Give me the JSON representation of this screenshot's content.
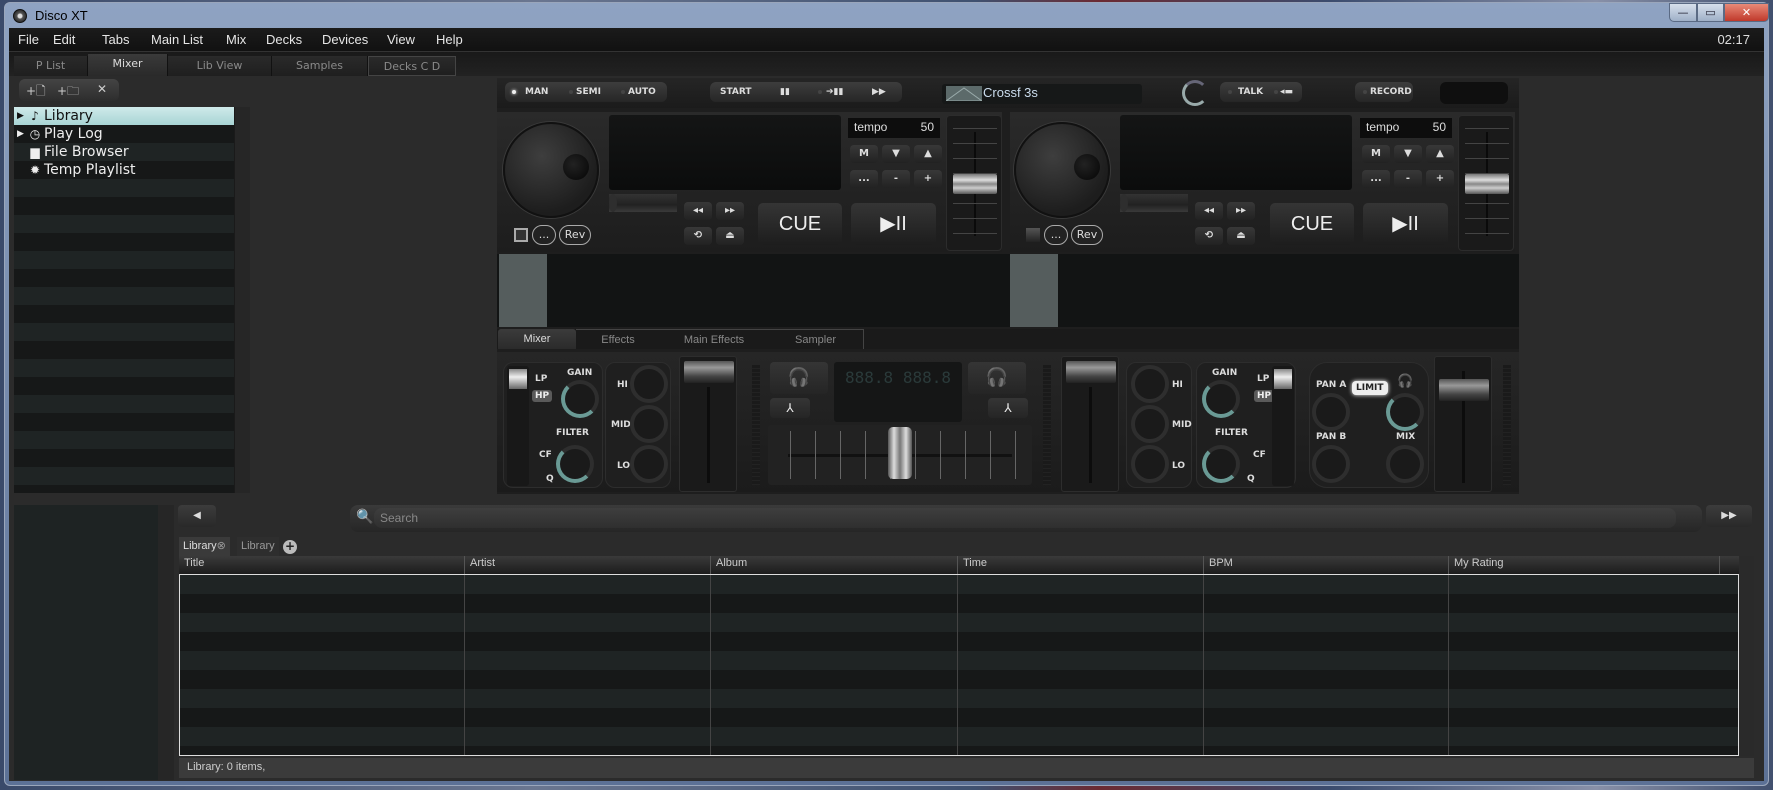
{
  "window": {
    "title": "Disco XT",
    "minimize": "—",
    "maximize": "▭",
    "close": "✕"
  },
  "menu": [
    "File",
    "Edit",
    "Tabs",
    "Main List",
    "Mix",
    "Decks",
    "Devices",
    "View",
    "Help"
  ],
  "clock": "02:17",
  "main_tabs": [
    {
      "label": "P List",
      "active": false
    },
    {
      "label": "Mixer",
      "active": true
    },
    {
      "label": "Lib View",
      "active": false
    },
    {
      "label": "Samples",
      "active": false
    },
    {
      "label": "Decks C D",
      "active": false
    }
  ],
  "tree_toolbar": {
    "new_playlist": "+🗋",
    "new_folder": "+🗀",
    "delete": "✕"
  },
  "tree": [
    {
      "label": "Library",
      "icon": "♪",
      "expandable": true,
      "selected": true
    },
    {
      "label": "Play Log",
      "icon": "◷",
      "expandable": true,
      "selected": false
    },
    {
      "label": "File Browser",
      "icon": "▆",
      "expandable": false,
      "selected": false
    },
    {
      "label": "Temp Playlist",
      "icon": "✹",
      "expandable": false,
      "selected": false
    }
  ],
  "top_strip": {
    "automix": {
      "man": "MAN",
      "semi": "SEMI",
      "auto": "AUTO",
      "active": "MAN"
    },
    "transport": {
      "start": "START",
      "pause": "▮▮",
      "next_pause": "➔▮▮",
      "skip": "▶▶"
    },
    "crossfade": "Crossf 3s",
    "talk": "TALK",
    "talk_icon": "◂▬",
    "record": "RECORD"
  },
  "decks": [
    {
      "tempo_label": "tempo",
      "tempo_value": "50",
      "btn_m": "M",
      "btn_down": "▼",
      "btn_up": "▲",
      "btn_more": "...",
      "btn_minus": "-",
      "btn_plus": "+",
      "rew": "◂◂",
      "ffw": "▸▸",
      "loop": "⟲",
      "eject": "⏏",
      "cue": "CUE",
      "play": "▶II",
      "more": "...",
      "rev": "Rev",
      "pitch": 0.5
    },
    {
      "tempo_label": "tempo",
      "tempo_value": "50",
      "btn_m": "M",
      "btn_down": "▼",
      "btn_up": "▲",
      "btn_more": "...",
      "btn_minus": "-",
      "btn_plus": "+",
      "rew": "◂◂",
      "ffw": "▸▸",
      "loop": "⟲",
      "eject": "⏏",
      "cue": "CUE",
      "play": "▶II",
      "more": "...",
      "rev": "Rev",
      "pitch": 0.5
    }
  ],
  "mixer_tabs": [
    {
      "label": "Mixer",
      "active": true
    },
    {
      "label": "Effects",
      "active": false
    },
    {
      "label": "Main Effects",
      "active": false
    },
    {
      "label": "Sampler",
      "active": false
    }
  ],
  "mixer": {
    "lp": "LP",
    "hp": "HP",
    "gain": "GAIN",
    "filter": "FILTER",
    "cf": "CF",
    "q": "Q",
    "hi": "HI",
    "mid": "MID",
    "lo": "LO",
    "bpm_display": "888.8  888.8",
    "headphone_icon": "🎧",
    "talk_icon": "⅄",
    "pan_a": "PAN A",
    "pan_b": "PAN B",
    "limit": "LIMIT",
    "mix": "MIX",
    "crossfader": 0.5
  },
  "library": {
    "prev": "◀",
    "next": "▶▶",
    "search_placeholder": "Search",
    "search_value": "",
    "tabs": [
      "Library",
      "Library"
    ],
    "tab_close": "⊗",
    "tab_add": "+",
    "columns": [
      "Title",
      "Artist",
      "Album",
      "Time",
      "BPM",
      "My Rating"
    ],
    "rows": [],
    "status": "Library: 0 items,"
  }
}
